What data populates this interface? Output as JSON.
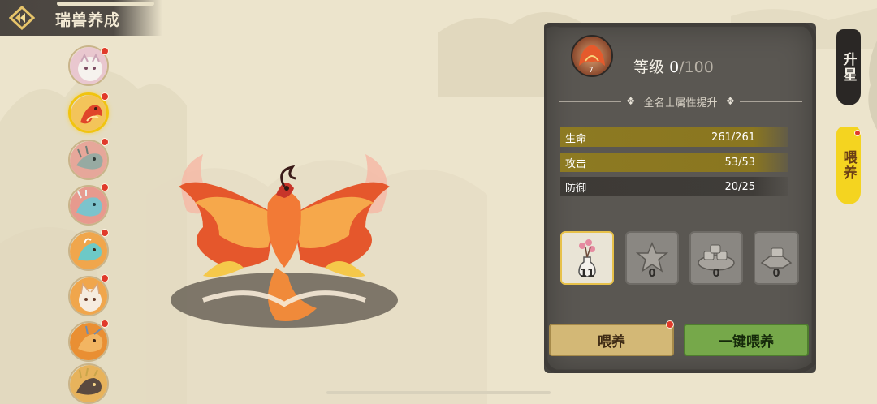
{
  "header": {
    "title": "瑞兽养成",
    "back_icon": "back-diamond-icon"
  },
  "beasts": [
    {
      "name": "white-tiger",
      "colors": [
        "#f3efe8",
        "#c9a7b8"
      ],
      "dot": true
    },
    {
      "name": "phoenix",
      "colors": [
        "#e8602a",
        "#f2c14f"
      ],
      "dot": true,
      "selected": true
    },
    {
      "name": "grey-dragon",
      "colors": [
        "#8aa09a",
        "#c6cfc4"
      ],
      "dot": true
    },
    {
      "name": "blue-dragon",
      "colors": [
        "#6fb8c4",
        "#e0f0ef"
      ],
      "dot": true
    },
    {
      "name": "qilin",
      "colors": [
        "#f39b3e",
        "#6cc7c6"
      ],
      "dot": true
    },
    {
      "name": "white-fox",
      "colors": [
        "#f4e4d0",
        "#c78b62"
      ],
      "dot": true
    },
    {
      "name": "orange-dragon",
      "colors": [
        "#e6862b",
        "#6e8db2"
      ],
      "dot": true
    },
    {
      "name": "golden-beast",
      "colors": [
        "#c89a3a",
        "#4b3e38"
      ],
      "dot": false
    }
  ],
  "panel": {
    "level_label": "等级",
    "level_current": "0",
    "level_max": "/100",
    "avatar_number": "7",
    "divider_text": "全名士属性提升",
    "stats": [
      {
        "label": "生命",
        "value": "261/261",
        "style": "gold"
      },
      {
        "label": "攻击",
        "value": "53/53",
        "style": "gold"
      },
      {
        "label": "防御",
        "value": "20/25",
        "style": "dark"
      }
    ],
    "items": [
      {
        "name": "flower-vase-icon",
        "count": "11",
        "selected": true
      },
      {
        "name": "star-stone-icon",
        "count": "0"
      },
      {
        "name": "food-plate-icon",
        "count": "0"
      },
      {
        "name": "ingot-icon",
        "count": "0"
      }
    ],
    "feed_button": "喂养",
    "auto_feed_button": "一键喂养"
  },
  "tabs": {
    "star": "升星",
    "feed": "喂养"
  },
  "colors": {
    "accent_gold": "#8d7a22",
    "tab_yellow": "#f4d420",
    "red_dot": "#e03a2b"
  }
}
